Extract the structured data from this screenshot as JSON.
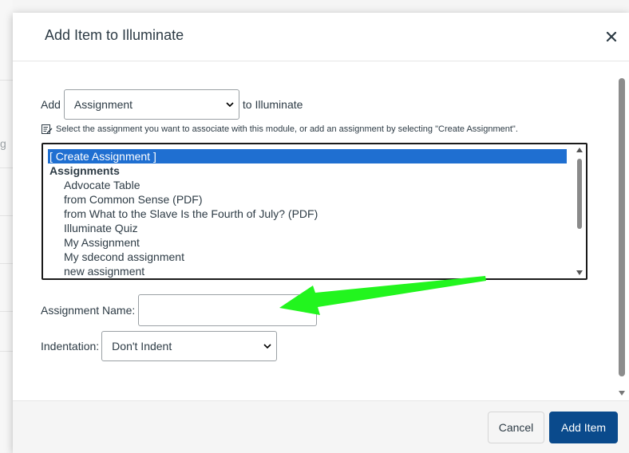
{
  "dialog": {
    "title": "Add Item to Illuminate",
    "close_icon": "close-icon"
  },
  "add_row": {
    "prefix": "Add",
    "type_select_value": "Assignment",
    "suffix": "to Illuminate"
  },
  "hint": {
    "icon": "edit-note-icon",
    "text": "Select the assignment you want to associate with this module, or add an assignment by selecting \"Create Assignment\"."
  },
  "listbox": {
    "selected": "[ Create Assignment ]",
    "group": "Assignments",
    "items": [
      "Advocate Table",
      "from Common Sense (PDF)",
      "from What to the Slave Is the Fourth of July? (PDF)",
      "Illuminate Quiz",
      "My Assignment",
      "My sdecond assignment",
      "new assignment"
    ]
  },
  "assignment_name": {
    "label": "Assignment Name:",
    "value": ""
  },
  "indentation": {
    "label": "Indentation:",
    "value": "Don't Indent"
  },
  "footer": {
    "cancel_label": "Cancel",
    "add_label": "Add Item"
  },
  "colors": {
    "primary_button": "#0a4a8c",
    "selection": "#1f6fd1",
    "annotation_arrow": "#22f51e"
  }
}
